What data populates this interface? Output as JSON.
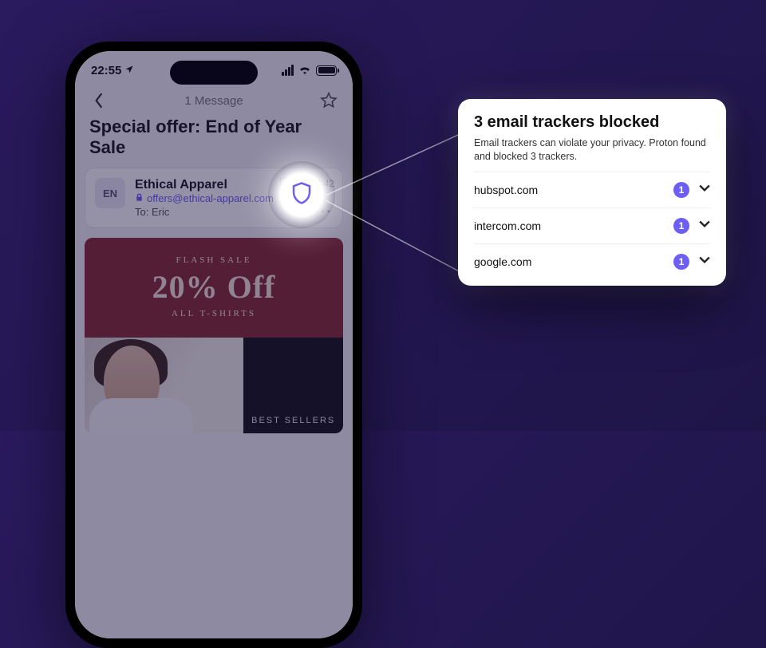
{
  "colors": {
    "accent": "#6d5ef6",
    "bannerBg": "#8a2e33"
  },
  "status": {
    "time": "22:55"
  },
  "nav": {
    "title": "1 Message"
  },
  "email": {
    "subject": "Special offer: End of Year Sale",
    "avatar_initials": "EN",
    "sender_name": "Ethical Apparel",
    "sender_email": "offers@ethical-apparel.com",
    "to_label": "To:",
    "to_name": "Eric",
    "time": "12:42"
  },
  "promo": {
    "kicker": "FLASH SALE",
    "headline": "20% Off",
    "sub": "ALL T-SHIRTS",
    "right_label": "BEST SELLERS"
  },
  "popup": {
    "title": "3 email trackers blocked",
    "desc": "Email trackers can violate your privacy. Proton found and blocked 3 trackers.",
    "trackers": [
      {
        "domain": "hubspot.com",
        "count": "1"
      },
      {
        "domain": "intercom.com",
        "count": "1"
      },
      {
        "domain": "google.com",
        "count": "1"
      }
    ]
  }
}
